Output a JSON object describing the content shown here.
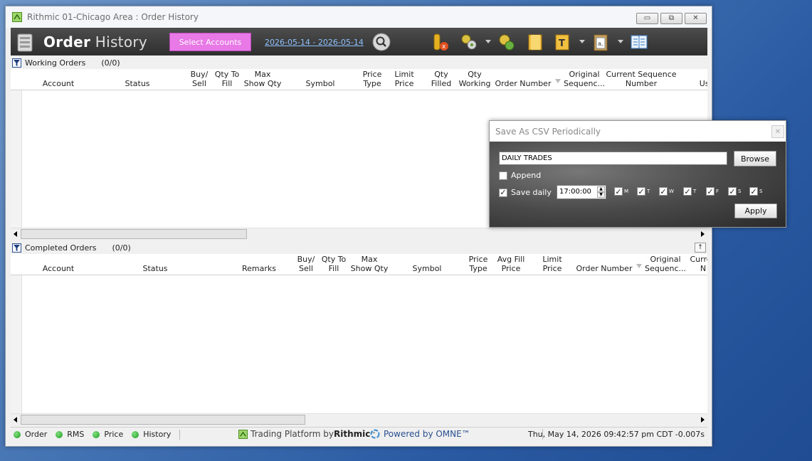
{
  "window": {
    "title": "Rithmic 01-Chicago Area : Order History",
    "controls": {
      "minimize": "▭",
      "restore": "⧉",
      "close": "✕"
    }
  },
  "toolbar": {
    "logo_bold": "Order",
    "logo_thin": " History",
    "select_accounts": "Select Accounts",
    "date_range": "2026-05-14  -  2026-05-14",
    "icons": [
      "search-icon",
      "clear-filter-icon",
      "settings-icon",
      "settings-group-icon",
      "folder-icon",
      "text-icon",
      "clipboard-icon",
      "columns-icon"
    ]
  },
  "working_orders": {
    "label": "Working Orders",
    "count": "(0/0)",
    "columns": [
      {
        "label": "Account"
      },
      {
        "label": "Status"
      },
      {
        "label": "Buy/\nSell"
      },
      {
        "label": "Qty To\nFill"
      },
      {
        "label": "Max\nShow Qty"
      },
      {
        "label": "Symbol"
      },
      {
        "label": "Price\nType"
      },
      {
        "label": "Limit\nPrice"
      },
      {
        "label": "Qty\nFilled"
      },
      {
        "label": "Qty\nWorking"
      },
      {
        "label": "Order Number"
      },
      {
        "label": "Original\nSequenc..."
      },
      {
        "label": "Current Sequence\nNumber"
      },
      {
        "label": "Use"
      }
    ]
  },
  "completed_orders": {
    "label": "Completed Orders",
    "count": "(0/0)",
    "columns": [
      {
        "label": "Account"
      },
      {
        "label": "Status"
      },
      {
        "label": "Remarks"
      },
      {
        "label": "Buy/\nSell"
      },
      {
        "label": "Qty To\nFill"
      },
      {
        "label": "Max\nShow Qty"
      },
      {
        "label": "Symbol"
      },
      {
        "label": "Price\nType"
      },
      {
        "label": "Avg Fill\nPrice"
      },
      {
        "label": "Limit\nPrice"
      },
      {
        "label": "Order Number"
      },
      {
        "label": "Original\nSequenc..."
      },
      {
        "label": "Curren\nN"
      }
    ]
  },
  "statusbar": {
    "items": [
      "Order",
      "RMS",
      "Price",
      "History"
    ],
    "brand_prefix": "Trading Platform by ",
    "brand_name": "Rithmic",
    "brand_tm": "™",
    "powered": "Powered by OMNE™",
    "clock": "Thu, May 14, 2026 09:42:57 pm CDT -0.007s",
    "status_color": "#1f9a1f"
  },
  "dialog": {
    "title": "Save As CSV Periodically",
    "close": "✕",
    "file_value": "DAILY TRADES",
    "browse": "Browse",
    "append_label": "Append",
    "append_checked": false,
    "save_daily_label": "Save daily",
    "save_daily_checked": true,
    "time": "17:00:00",
    "days": [
      {
        "label": "M",
        "checked": true
      },
      {
        "label": "T",
        "checked": true
      },
      {
        "label": "W",
        "checked": true
      },
      {
        "label": "T",
        "checked": true
      },
      {
        "label": "F",
        "checked": true
      },
      {
        "label": "S",
        "checked": true
      },
      {
        "label": "S",
        "checked": true
      }
    ],
    "apply": "Apply"
  }
}
